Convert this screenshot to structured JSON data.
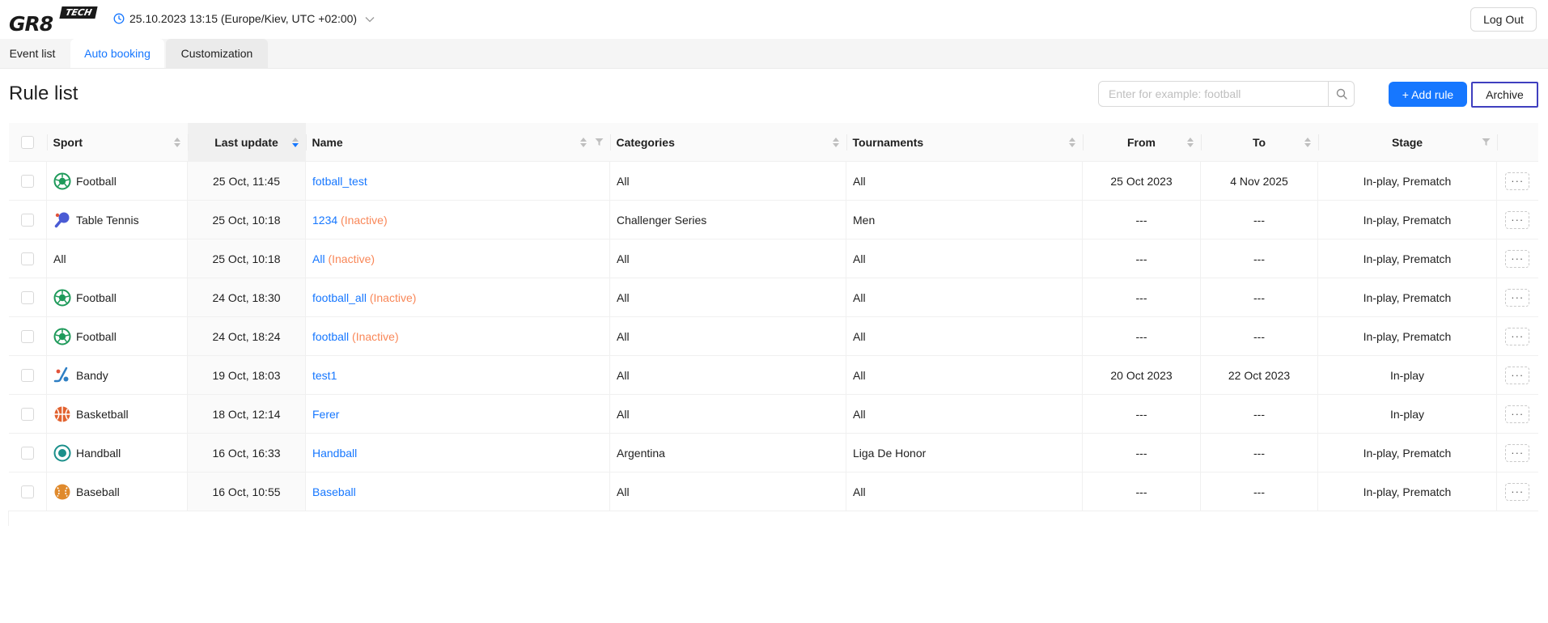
{
  "app": {
    "logo": "GR8",
    "logo_badge": "TECH"
  },
  "header": {
    "datetime": "25.10.2023 13:15 (Europe/Kiev, UTC +02:00)",
    "logout_label": "Log Out"
  },
  "tabs": [
    {
      "label": "Event list",
      "active": false
    },
    {
      "label": "Auto booking",
      "active": true
    },
    {
      "label": "Customization",
      "active": false
    }
  ],
  "page": {
    "title": "Rule list"
  },
  "search": {
    "placeholder": "Enter for example: football",
    "value": ""
  },
  "toolbar": {
    "add_rule_label": "+ Add rule",
    "archive_label": "Archive"
  },
  "table": {
    "columns": [
      "Sport",
      "Last update",
      "Name",
      "Categories",
      "Tournaments",
      "From",
      "To",
      "Stage"
    ],
    "rows": [
      {
        "sport": "Football",
        "icon": "football-icon",
        "last_update": "25 Oct, 11:45",
        "name": "fotball_test",
        "inactive": "",
        "categories": "All",
        "tournaments": "All",
        "from": "25 Oct 2023",
        "to": "4 Nov 2025",
        "stage": "In-play, Prematch"
      },
      {
        "sport": "Table Tennis",
        "icon": "table-tennis-icon",
        "last_update": "25 Oct, 10:18",
        "name": "1234",
        "inactive": "(Inactive)",
        "categories": "Challenger Series",
        "tournaments": "Men",
        "from": "---",
        "to": "---",
        "stage": "In-play, Prematch"
      },
      {
        "sport": "All",
        "icon": "",
        "last_update": "25 Oct, 10:18",
        "name": "All",
        "inactive": "(Inactive)",
        "categories": "All",
        "tournaments": "All",
        "from": "---",
        "to": "---",
        "stage": "In-play, Prematch"
      },
      {
        "sport": "Football",
        "icon": "football-icon",
        "last_update": "24 Oct, 18:30",
        "name": "football_all",
        "inactive": "(Inactive)",
        "categories": "All",
        "tournaments": "All",
        "from": "---",
        "to": "---",
        "stage": "In-play, Prematch"
      },
      {
        "sport": "Football",
        "icon": "football-icon",
        "last_update": "24 Oct, 18:24",
        "name": "football",
        "inactive": "(Inactive)",
        "categories": "All",
        "tournaments": "All",
        "from": "---",
        "to": "---",
        "stage": "In-play, Prematch"
      },
      {
        "sport": "Bandy",
        "icon": "bandy-icon",
        "last_update": "19 Oct, 18:03",
        "name": "test1",
        "inactive": "",
        "categories": "All",
        "tournaments": "All",
        "from": "20 Oct 2023",
        "to": "22 Oct 2023",
        "stage": "In-play"
      },
      {
        "sport": "Basketball",
        "icon": "basketball-icon",
        "last_update": "18 Oct, 12:14",
        "name": "Ferer",
        "inactive": "",
        "categories": "All",
        "tournaments": "All",
        "from": "---",
        "to": "---",
        "stage": "In-play"
      },
      {
        "sport": "Handball",
        "icon": "handball-icon",
        "last_update": "16 Oct, 16:33",
        "name": "Handball",
        "inactive": "",
        "categories": "Argentina",
        "tournaments": "Liga De Honor",
        "from": "---",
        "to": "---",
        "stage": "In-play, Prematch"
      },
      {
        "sport": "Baseball",
        "icon": "baseball-icon",
        "last_update": "16 Oct, 10:55",
        "name": "Baseball",
        "inactive": "",
        "categories": "All",
        "tournaments": "All",
        "from": "---",
        "to": "---",
        "stage": "In-play, Prematch"
      }
    ],
    "more_label": "···"
  },
  "colors": {
    "accent": "#1677ff",
    "inactive": "#f98758",
    "archive_border": "#3f3fbf"
  }
}
